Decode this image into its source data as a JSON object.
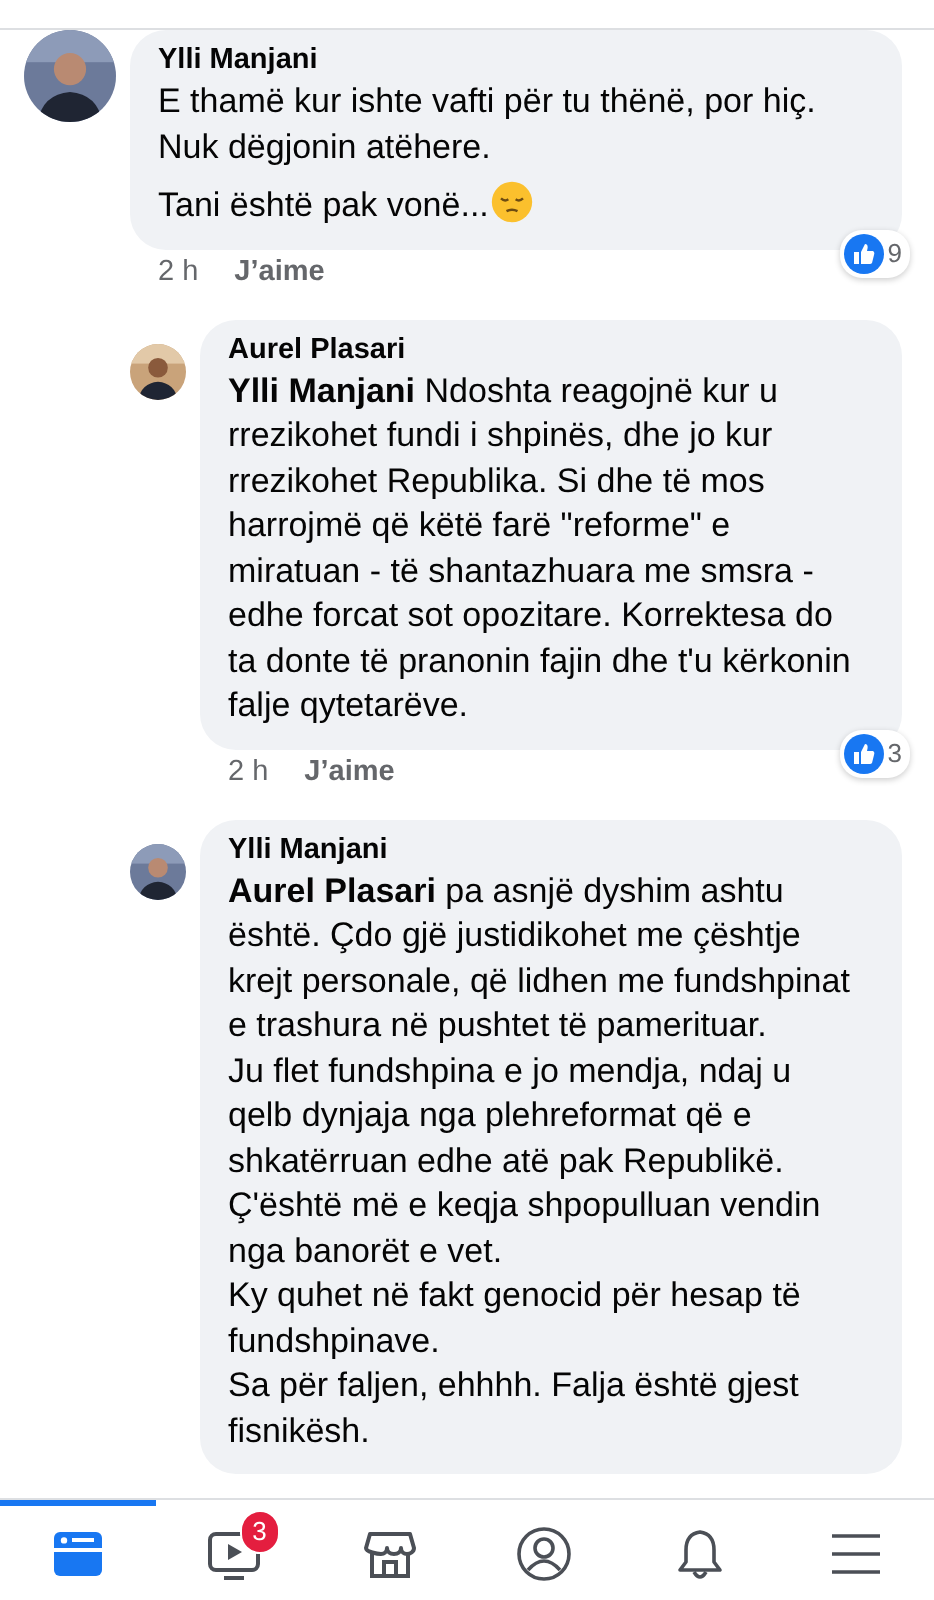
{
  "comments": [
    {
      "author": "Ylli Manjani",
      "paragraphs": [
        "E thamë kur ishte vafti për tu thënë, por hiç.\nNuk dëgjonin atëhere.",
        "Tani është pak vonë..."
      ],
      "emoji_after": true,
      "time": "2 h",
      "like_label": "J’aime",
      "reaction_count": "9",
      "reply": false
    },
    {
      "author": "Aurel Plasari",
      "paragraphs": [
        "**Ylli Manjani** Ndoshta reagojnë kur u rrezikohet fundi i shpinës, dhe jo kur rrezikohet Republika. Si dhe të mos harrojmë që këtë farë \"reforme\" e miratuan - të shantazhuara me smsra - edhe forcat sot opozitare. Korrektesa do ta donte të pranonin fajin dhe t'u kërkonin falje qytetarëve."
      ],
      "time": "2 h",
      "like_label": "J’aime",
      "reaction_count": "3",
      "reply": true
    },
    {
      "author": "Ylli Manjani",
      "paragraphs": [
        "**Aurel Plasari** pa asnjë dyshim ashtu është. Çdo gjë justidikohet me çështje krejt personale, që lidhen me fundshpinat e trashura në pushtet të pamerituar.\nJu flet fundshpina e jo mendja, ndaj u qelb dynjaja nga plehreformat që e shkatërruan edhe atë pak Republikë.\nÇ'është më e keqja shpopulluan vendin nga banorët e vet.\nKy quhet në fakt genocid për hesap të fundshpinave.\nSa për faljen, ehhhh. Falja është gjest fisnikësh."
      ],
      "reply": true
    }
  ],
  "tab_bar": [
    {
      "kind": "feed",
      "selected": true
    },
    {
      "kind": "video",
      "selected": false,
      "badge": "3"
    },
    {
      "kind": "marketplace",
      "selected": false
    },
    {
      "kind": "profile",
      "selected": false
    },
    {
      "kind": "notifications",
      "selected": false
    },
    {
      "kind": "menu",
      "selected": false
    }
  ]
}
